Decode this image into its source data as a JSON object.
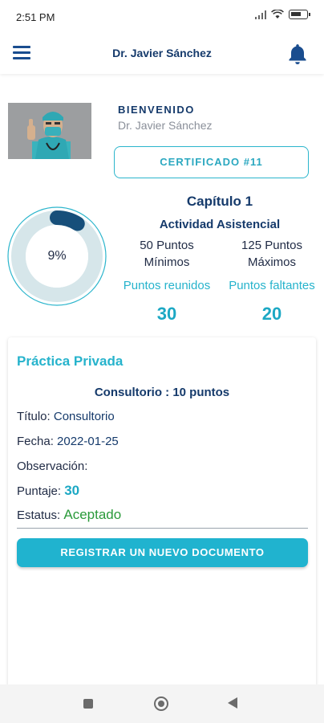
{
  "status_bar": {
    "time": "2:51 PM",
    "icons": [
      "signal-icon",
      "wifi-icon",
      "battery-icon"
    ],
    "battery_level": 0.5
  },
  "app_bar": {
    "title": "Dr. Javier Sánchez",
    "menu_icon": "hamburger-menu-icon",
    "notification_icon": "bell-icon"
  },
  "profile": {
    "welcome": "BIENVENIDO",
    "name": "Dr. Javier Sánchez",
    "certificate_button": "CERTIFICADO #11"
  },
  "progress": {
    "percent": 9,
    "percent_label": "9%",
    "colors": {
      "track": "#d6e6ea",
      "fill": "#174f7a",
      "ring_border": "#2bb5cc"
    }
  },
  "chapter": {
    "title": "Capítulo 1",
    "activity": "Actividad Asistencial",
    "min_points": "50 Puntos",
    "min_label": "Mínimos",
    "max_points": "125 Puntos",
    "max_label": "Máximos",
    "collected_label": "Puntos reunidos",
    "missing_label": "Puntos faltantes",
    "collected_value": "30",
    "missing_value": "20"
  },
  "record": {
    "section_title": "Práctica Privada",
    "subtitle": "Consultorio : 10 puntos",
    "title_label": "Título: ",
    "title_value": "Consultorio",
    "date_label": "Fecha: ",
    "date_value": "2022-01-25",
    "observation_label": "Observación:",
    "observation_value": "",
    "score_label": "Puntaje: ",
    "score_value": "30",
    "status_label": "Estatus: ",
    "status_value": "Aceptado",
    "register_button": "REGISTRAR UN NUEVO DOCUMENTO"
  },
  "nav_bar": {
    "buttons": [
      "recents-icon",
      "home-icon",
      "back-icon"
    ]
  },
  "theme": {
    "primary": "#20b3cf",
    "dark_blue": "#153a6b",
    "success": "#2a9a3a"
  }
}
